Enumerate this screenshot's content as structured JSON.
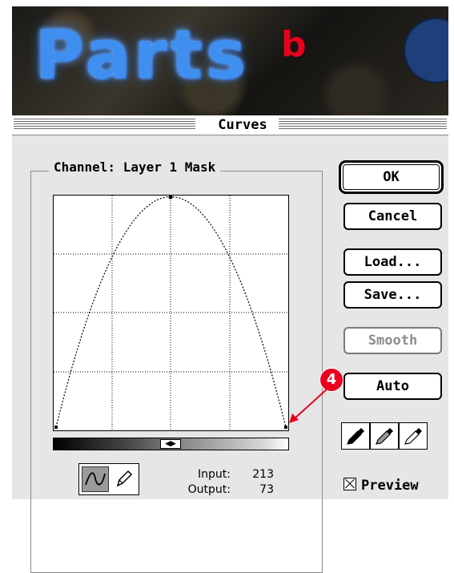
{
  "banner": {
    "title": "Parts",
    "badge": "b"
  },
  "window": {
    "title": "Curves"
  },
  "channel": {
    "label": "Channel: Layer 1 Mask"
  },
  "buttons": {
    "ok": "OK",
    "cancel": "Cancel",
    "load": "Load...",
    "save": "Save...",
    "smooth": "Smooth",
    "auto": "Auto"
  },
  "readout": {
    "input_label": "Input:",
    "input_value": "213",
    "output_label": "Output:",
    "output_value": "73"
  },
  "preview": {
    "label": "Preview",
    "checked": true
  },
  "callout": {
    "number": "4",
    "color": "#e8001c"
  },
  "tools": {
    "active": "curve-tool",
    "items": [
      "curve-icon",
      "pencil-icon"
    ]
  },
  "eyedroppers": [
    "black-eyedropper-icon",
    "gray-eyedropper-icon",
    "white-eyedropper-icon"
  ],
  "curve": {
    "points": [
      {
        "input": 0,
        "output": 0
      },
      {
        "input": 128,
        "output": 255
      },
      {
        "input": 255,
        "output": 0
      }
    ]
  }
}
